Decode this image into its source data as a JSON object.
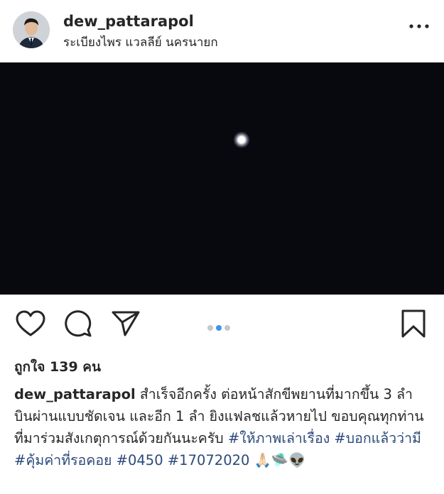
{
  "post": {
    "username": "dew_pattarapol",
    "location": "ระเบียงไพร แวลลีย์ นครนายก"
  },
  "actions": {
    "carousel": {
      "total": 3,
      "active_index": 1
    }
  },
  "likes_text": "ถูกใจ 139 คน",
  "caption": {
    "username": "dew_pattarapol",
    "text": "สำเร็จอีกครั้ง ต่อหน้าสักขีพยานที่มากขึ้น 3 ลำ บินผ่านแบบชัดเจน และอีก 1 ลำ ยิงแฟลชแล้วหายไป ขอบคุณทุกท่านที่มาร่วมสังเกตุการณ์ด้วยกันนะครับ",
    "hashtags": [
      "#ให้ภาพเล่าเรื่อง",
      "#บอกแล้วว่ามี",
      "#คุ้มค่าที่รอคอย",
      "#0450",
      "#17072020"
    ],
    "emoji": "🙏🏻🛸👽"
  },
  "colors": {
    "link": "#2c4a7a",
    "dot_active": "#3897f0",
    "dot_inactive": "#c7c7c7",
    "photo_bg": "#08080f"
  }
}
